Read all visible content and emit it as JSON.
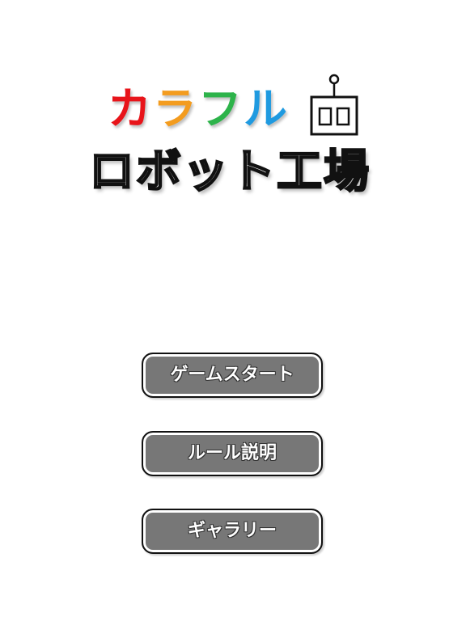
{
  "title": {
    "line1_chars": [
      {
        "text": "カ",
        "color": "#e8141a"
      },
      {
        "text": "ラ",
        "color": "#f39c1f"
      },
      {
        "text": "フ",
        "color": "#2db34a"
      },
      {
        "text": "ル",
        "color": "#1f9ae0"
      }
    ],
    "line2": "ロボット工場"
  },
  "menu": {
    "start_label": "ゲームスタート",
    "rules_label": "ルール説明",
    "gallery_label": "ギャラリー"
  },
  "colors": {
    "button_fill": "#777777",
    "button_border": "#111111",
    "background": "#ffffff"
  },
  "icons": {
    "logo": "robot-head-icon"
  }
}
